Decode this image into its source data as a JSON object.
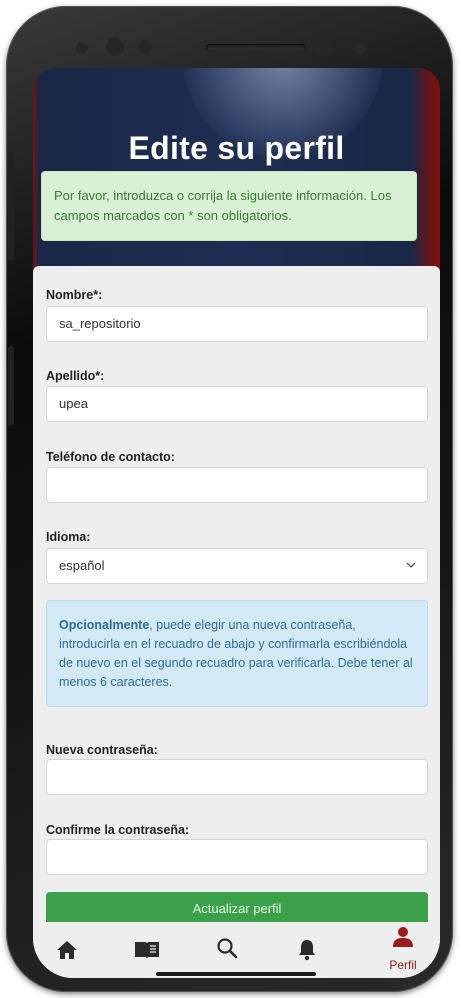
{
  "header": {
    "title": "Edite su perfil"
  },
  "success_alert": {
    "text": "Por favor, introduzca o corrija la siguiente información. Los campos marcados con * son obligatorios."
  },
  "form": {
    "nombre": {
      "label": "Nombre*:",
      "value": "sa_repositorio"
    },
    "apellido": {
      "label": "Apellido*:",
      "value": "upea"
    },
    "telefono": {
      "label": "Teléfono de contacto:",
      "value": ""
    },
    "idioma": {
      "label": "Idioma:",
      "selected": "español"
    },
    "info": {
      "bold": "Opcionalmente",
      "text": ", puede elegir una nueva contraseña, introducirla en el recuadro de abajo y confirmarla escribiéndola de nuevo en el segundo recuadro para verificarla. Debe tener al menos 6 caracteres."
    },
    "nueva_contrasena": {
      "label": "Nueva contraseña:",
      "value": ""
    },
    "confirmar_contrasena": {
      "label": "Confirme la contraseña:",
      "value": ""
    },
    "submit_label": "Actualizar perfil"
  },
  "bottom_nav": {
    "items": [
      {
        "icon": "home-icon"
      },
      {
        "icon": "book-icon"
      },
      {
        "icon": "search-icon"
      },
      {
        "icon": "bell-icon"
      },
      {
        "icon": "user-icon",
        "label": "Perfil",
        "active": true
      }
    ]
  },
  "colors": {
    "header_bg": "#1e2d52",
    "success_bg": "#d8f0d4",
    "info_bg": "#d4e9f6",
    "submit_bg": "#3aa14a",
    "active_nav": "#9b1b1b"
  }
}
